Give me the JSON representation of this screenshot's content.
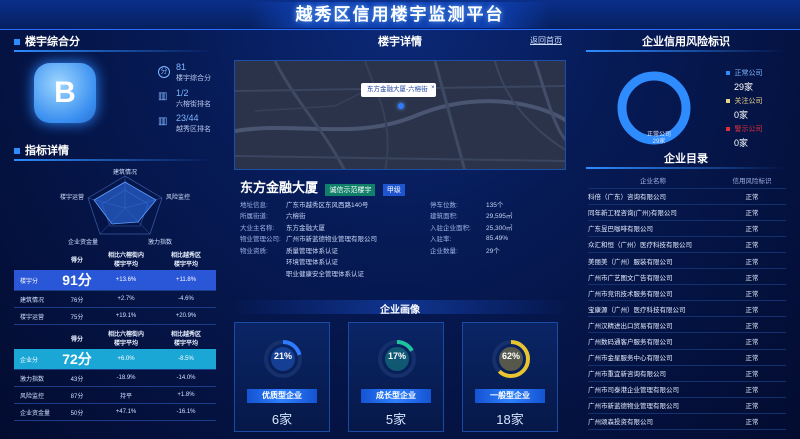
{
  "header": {
    "title": "越秀区信用楼宇监测平台"
  },
  "left": {
    "score_title": "楼宇综合分",
    "badge_letter": "B",
    "stats": [
      {
        "value": "81",
        "label": "楼宇综合分"
      },
      {
        "value": "1/2",
        "label": "六榕街排名"
      },
      {
        "value": "23/44",
        "label": "越秀区排名"
      }
    ],
    "detail_title": "指标详情",
    "radar_labels": [
      "建筑情况",
      "风险监控",
      "激力指数",
      "企业资金量",
      "楼宇运营"
    ],
    "table1": {
      "headers": [
        "",
        "得分",
        "相比六榕街内\n楼宇平均",
        "相比越秀区\n楼宇平均"
      ],
      "rows": [
        {
          "name": "楼宇分",
          "score": "91分",
          "a": "+13.6%",
          "b": "+11.8%"
        },
        {
          "name": "建筑情况",
          "score": "76分",
          "a": "+2.7%",
          "b": "-4.6%"
        },
        {
          "name": "楼宇运营",
          "score": "75分",
          "a": "+19.1%",
          "b": "+20.9%"
        }
      ]
    },
    "table2": {
      "headers": [
        "",
        "得分",
        "相比六榕街内\n楼宇平均",
        "相比越秀区\n楼宇平均"
      ],
      "rows": [
        {
          "name": "企业分",
          "score": "72分",
          "a": "+6.0%",
          "b": "-8.5%"
        },
        {
          "name": "激力指数",
          "score": "43分",
          "a": "-18.9%",
          "b": "-14.0%"
        },
        {
          "name": "风险监控",
          "score": "87分",
          "a": "持平",
          "b": "+1.8%"
        },
        {
          "name": "企业资金量",
          "score": "50分",
          "a": "+47.1%",
          "b": "-16.1%"
        }
      ]
    }
  },
  "center": {
    "title": "楼宇详情",
    "back": "返回首页",
    "map_pin": "东方金融大厦-六榕街",
    "building_name": "东方金融大厦",
    "tag1": "诚信示范楼宇",
    "tag2": "甲级",
    "info_left": [
      {
        "k": "地址信息:",
        "v": "广东市越秀区东风西路140号"
      },
      {
        "k": "所属街道:",
        "v": "六榕街"
      },
      {
        "k": "大业主名称:",
        "v": "东方金融大厦"
      },
      {
        "k": "物业管理公司:",
        "v": "广州市新蓝德物业管理有限公司"
      },
      {
        "k": "物业资质:",
        "v": "质量管理体系认证"
      },
      {
        "k": "",
        "v": "环境管理体系认证"
      },
      {
        "k": "",
        "v": "职业健康安全管理体系认证"
      }
    ],
    "info_right": [
      {
        "k": "停车位数:",
        "v": "135个"
      },
      {
        "k": "建筑面积:",
        "v": "29,595㎡"
      },
      {
        "k": "入驻企业面积:",
        "v": "25,300㎡"
      },
      {
        "k": "入驻率:",
        "v": "85.49%"
      },
      {
        "k": "企业数量:",
        "v": "29个"
      }
    ],
    "portrait_title": "企业画像",
    "cards": [
      {
        "pct": "21%",
        "pct_value": 21,
        "label": "优质型企业",
        "count": "6家",
        "color": "#2f7bff"
      },
      {
        "pct": "17%",
        "pct_value": 17,
        "label": "成长型企业",
        "count": "5家",
        "color": "#20c3a0"
      },
      {
        "pct": "62%",
        "pct_value": 62,
        "label": "一般型企业",
        "count": "18家",
        "color": "#e8c430"
      }
    ]
  },
  "right": {
    "risk_title": "企业信用风险标识",
    "legend": [
      {
        "label": "正常公司",
        "count": "29家",
        "color": "#2e8cff"
      },
      {
        "label": "关注公司",
        "count": "0家",
        "color": "#e8d28a"
      },
      {
        "label": "警示公司",
        "count": "0家",
        "color": "#e0303a"
      }
    ],
    "donut_label": "正常公司",
    "donut_count": "29家",
    "list_title": "企业目录",
    "list_headers": [
      "企业名称",
      "信用风险标识"
    ],
    "companies": [
      {
        "name": "科倍（广东）咨询有限公司",
        "status": "正常"
      },
      {
        "name": "同年新工程咨询(广州)有限公司",
        "status": "正常"
      },
      {
        "name": "广东昱巴咖啡有限公司",
        "status": "正常"
      },
      {
        "name": "众汇和恒（广州）医疗科技有限公司",
        "status": "正常"
      },
      {
        "name": "美丽美（广州）服装有限公司",
        "status": "正常"
      },
      {
        "name": "广州市广艺图文广告有限公司",
        "status": "正常"
      },
      {
        "name": "广州市竞讯技术服务有限公司",
        "status": "正常"
      },
      {
        "name": "宝康源（广州）医疗科技有限公司",
        "status": "正常"
      },
      {
        "name": "广州汉精进出口贸易有限公司",
        "status": "正常"
      },
      {
        "name": "广州数码通客户服务有限公司",
        "status": "正常"
      },
      {
        "name": "广州市金星服务中心有限公司",
        "status": "正常"
      },
      {
        "name": "广州市重宜新咨询有限公司",
        "status": "正常"
      },
      {
        "name": "广州市司泰港企业管理有限公司",
        "status": "正常"
      },
      {
        "name": "广州市新蓝德物业管理有限公司",
        "status": "正常"
      },
      {
        "name": "广州颂森投资有限公司",
        "status": "正常"
      }
    ]
  }
}
